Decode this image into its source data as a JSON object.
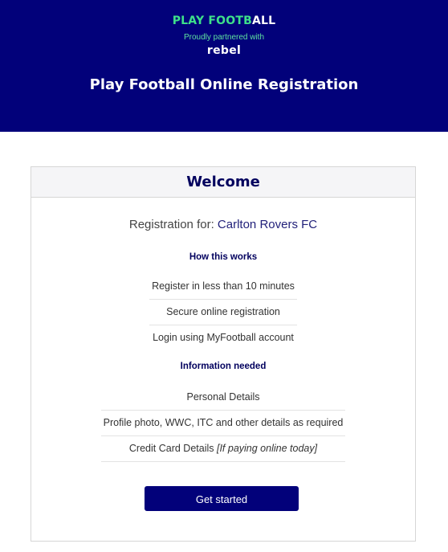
{
  "header": {
    "brand_part_a": "PLAY FOOTB",
    "brand_part_b": "ALL",
    "partner_text": "Proudly partnered with",
    "partner_logo": "rebel",
    "title": "Play Football Online Registration"
  },
  "card": {
    "title": "Welcome",
    "registration_prefix": "Registration for:",
    "club_name": "Carlton Rovers FC",
    "how_title": "How this works",
    "how_items": [
      "Register in less than 10 minutes",
      "Secure online registration",
      "Login using MyFootball account"
    ],
    "info_title": "Information needed",
    "info_items": [
      "Personal Details",
      "Profile photo, WWC, ITC and other details as required"
    ],
    "info_last_prefix": "Credit Card Details",
    "info_last_note": "[If paying online today]",
    "cta_label": "Get started"
  },
  "colors": {
    "header_bg": "#02017a",
    "brand_green": "#3ee08a",
    "title_navy": "#02015e",
    "button_bg": "#02017a"
  }
}
